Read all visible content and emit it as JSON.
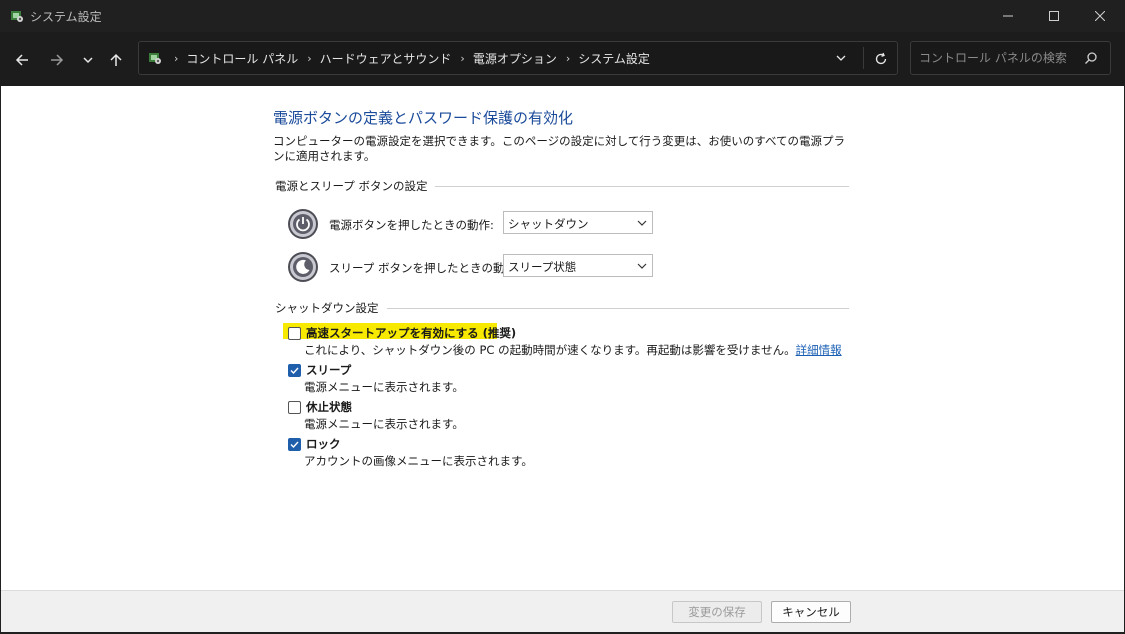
{
  "window": {
    "title": "システム設定",
    "icon": "control-panel-icon"
  },
  "nav": {
    "breadcrumbs": [
      "コントロール パネル",
      "ハードウェアとサウンド",
      "電源オプション",
      "システム設定"
    ],
    "search_placeholder": "コントロール パネルの検索"
  },
  "page": {
    "title": "電源ボタンの定義とパスワード保護の有効化",
    "description": "コンピューターの電源設定を選択できます。このページの設定に対して行う変更は、お使いのすべての電源プランに適用されます。"
  },
  "power_section": {
    "heading": "電源とスリープ ボタンの設定",
    "power_button": {
      "label": "電源ボタンを押したときの動作:",
      "value": "シャットダウン"
    },
    "sleep_button": {
      "label": "スリープ ボタンを押したときの動作:",
      "value": "スリープ状態"
    }
  },
  "shutdown_section": {
    "heading": "シャットダウン設定",
    "fast_startup": {
      "label": "高速スタートアップを有効にする (推奨)",
      "desc": "これにより、シャットダウン後の PC の起動時間が速くなります。再起動は影響を受けません。",
      "link": "詳細情報",
      "checked": false
    },
    "sleep": {
      "label": "スリープ",
      "desc": "電源メニューに表示されます。",
      "checked": true
    },
    "hibernate": {
      "label": "休止状態",
      "desc": "電源メニューに表示されます。",
      "checked": false
    },
    "lock": {
      "label": "ロック",
      "desc": "アカウントの画像メニューに表示されます。",
      "checked": true
    }
  },
  "footer": {
    "save_label": "変更の保存",
    "cancel_label": "キャンセル"
  },
  "colors": {
    "accent": "#1f5eab",
    "title_blue": "#1a4a9a",
    "highlight": "#f7ea00"
  }
}
